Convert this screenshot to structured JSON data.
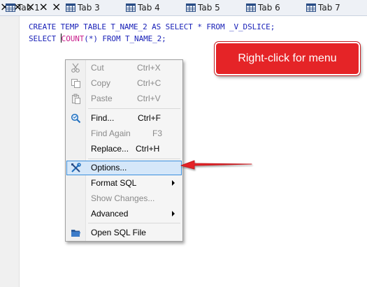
{
  "tabs": [
    {
      "label": "Tab 1",
      "close": "×"
    },
    {
      "label": "Tab 3",
      "close": "×"
    },
    {
      "label": "Tab 4",
      "close": "×"
    },
    {
      "label": "Tab 5",
      "close": "×"
    },
    {
      "label": "Tab 6",
      "close": "×"
    },
    {
      "label": "Tab 7",
      "close": "×"
    }
  ],
  "editor": {
    "line1": "CREATE TEMP TABLE T_NAME_2 AS SELECT * FROM _V_DSLICE;",
    "line2_a": "SELECT ",
    "line2_fn": "COUNT",
    "line2_b": "(*) FROM T_NAME_2;"
  },
  "callout": {
    "text": "Right-click for menu",
    "color": "#e52427"
  },
  "menu": {
    "cut": {
      "label": "Cut",
      "shortcut": "Ctrl+X"
    },
    "copy": {
      "label": "Copy",
      "shortcut": "Ctrl+C"
    },
    "paste": {
      "label": "Paste",
      "shortcut": "Ctrl+V"
    },
    "find": {
      "label": "Find...",
      "shortcut": "Ctrl+F"
    },
    "find_again": {
      "label": "Find Again",
      "shortcut": "F3"
    },
    "replace": {
      "label": "Replace...",
      "shortcut": "Ctrl+H"
    },
    "options": {
      "label": "Options..."
    },
    "format_sql": {
      "label": "Format SQL"
    },
    "show_changes": {
      "label": "Show Changes..."
    },
    "advanced": {
      "label": "Advanced"
    },
    "open_sql": {
      "label": "Open SQL File"
    }
  },
  "icons": {
    "tab": "table-grid-icon",
    "cut": "scissors-icon",
    "copy": "copy-icon",
    "paste": "clipboard-icon",
    "find": "magnifier-icon",
    "options": "tools-icon",
    "open": "folder-icon"
  }
}
